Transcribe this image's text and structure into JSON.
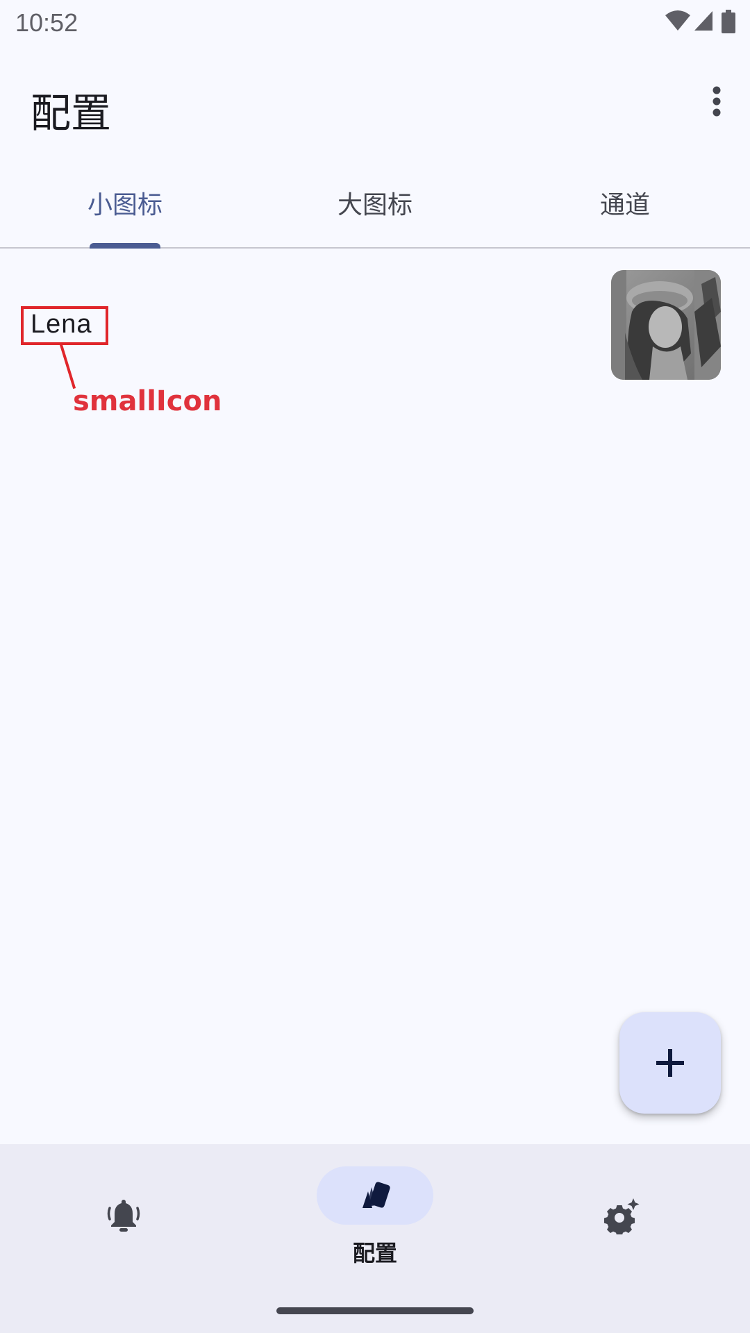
{
  "status_bar": {
    "time": "10:52",
    "icons": [
      "wifi-icon",
      "signal-icon",
      "battery-icon"
    ]
  },
  "app_bar": {
    "title": "配置",
    "menu_icon": "more-vert-icon"
  },
  "tabs": [
    {
      "label": "小图标",
      "active": true
    },
    {
      "label": "大图标",
      "active": false
    },
    {
      "label": "通道",
      "active": false
    }
  ],
  "list": {
    "items": [
      {
        "title": "Lena",
        "thumbnail": "lena-image"
      }
    ]
  },
  "annotation": {
    "label": "smallIcon",
    "color": "#e0262b"
  },
  "fab": {
    "icon": "add-icon"
  },
  "bottom_nav": {
    "items": [
      {
        "icon": "bell-icon",
        "label": "",
        "active": false
      },
      {
        "icon": "cards-icon",
        "label": "配置",
        "active": true
      },
      {
        "icon": "settings-icon",
        "label": "",
        "active": false
      }
    ]
  },
  "colors": {
    "accent": "#4b5c92",
    "fab_bg": "#dce1fb",
    "nav_bg": "#ebebf5",
    "background": "#f8f9ff"
  }
}
